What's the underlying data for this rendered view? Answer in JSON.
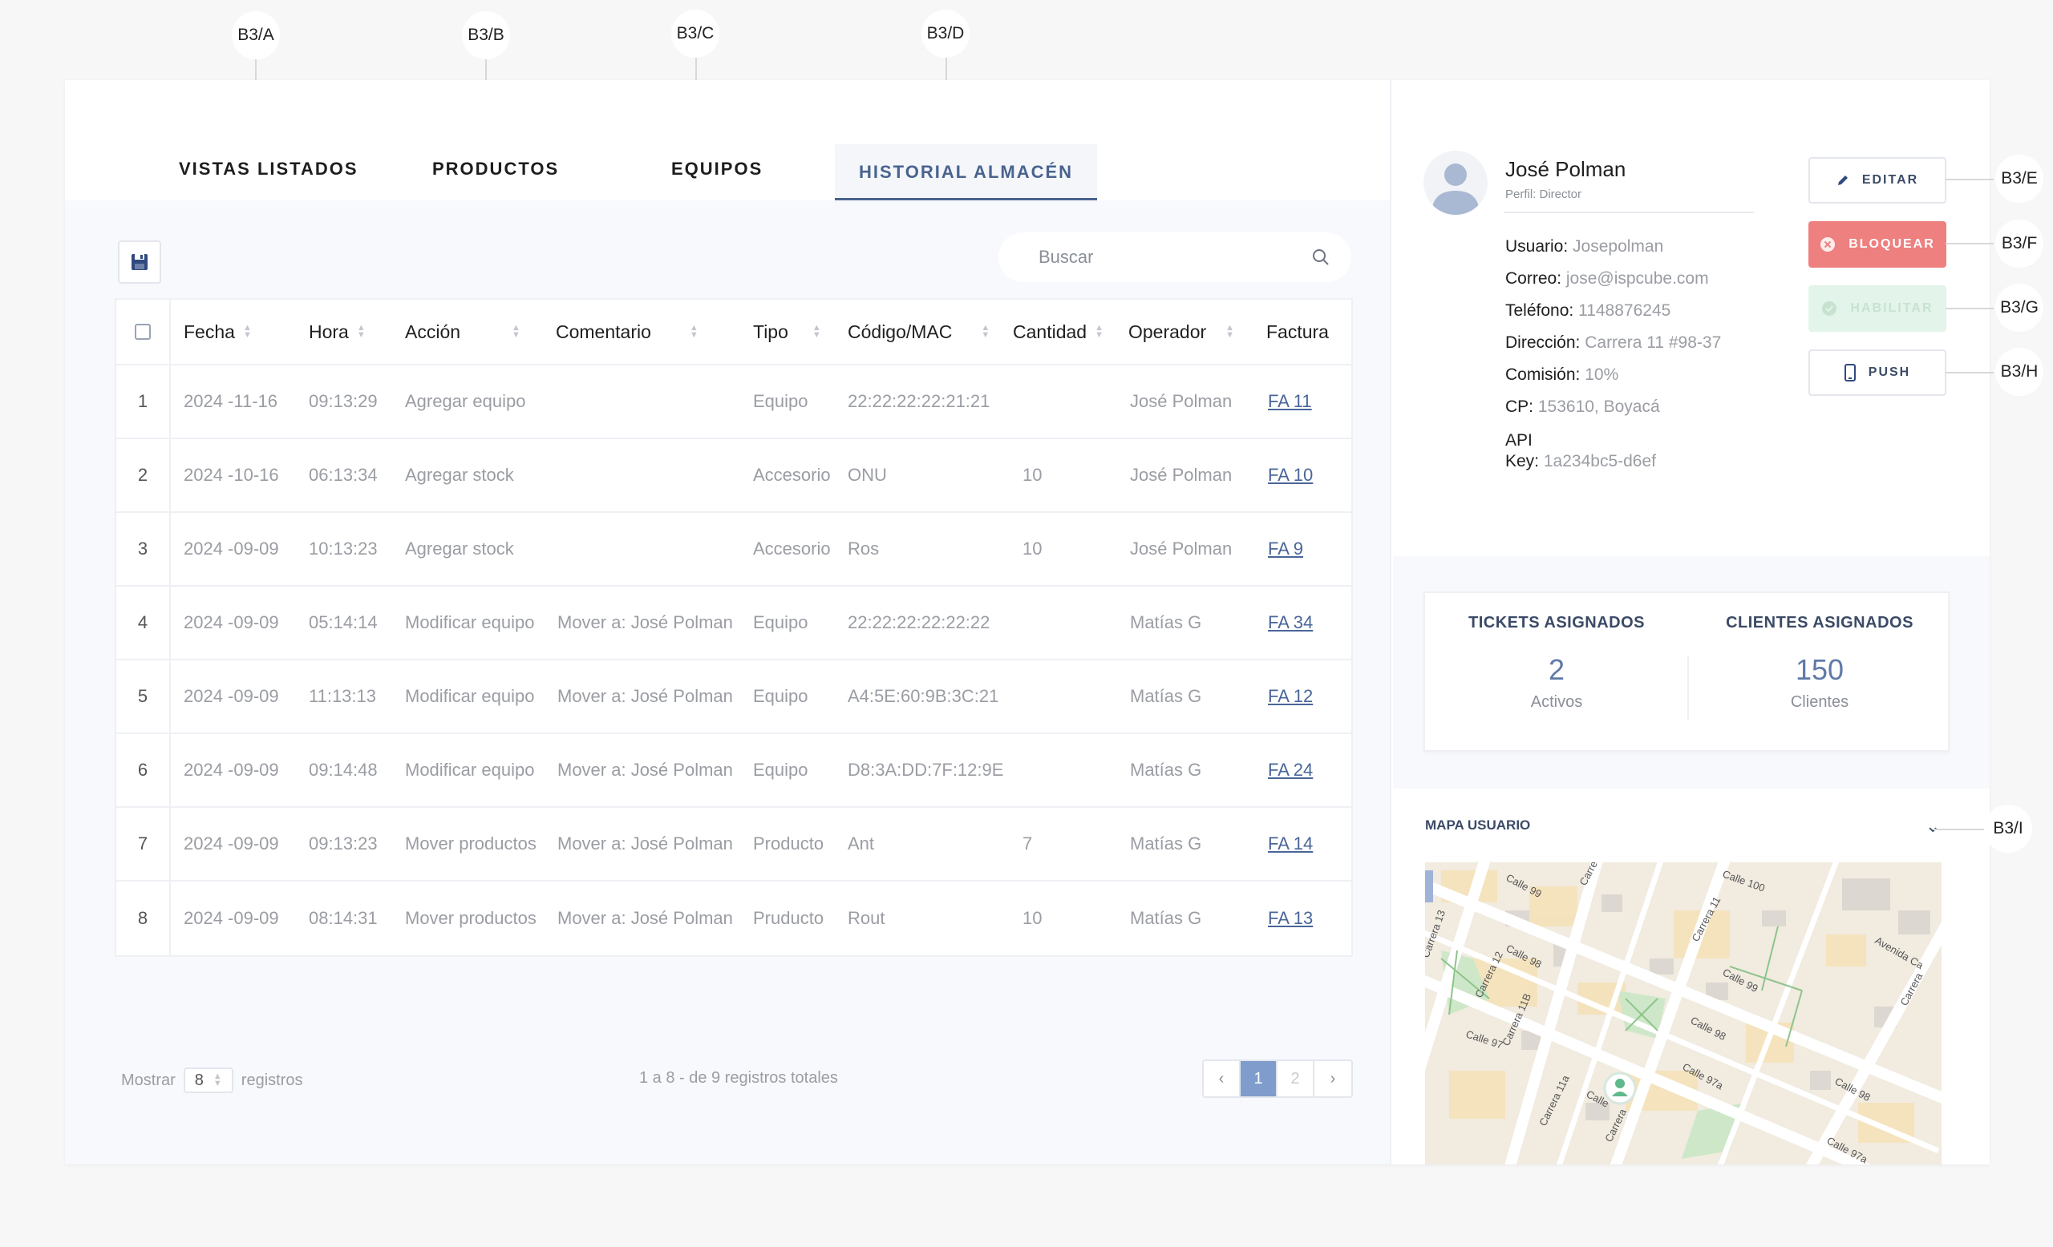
{
  "annotations": [
    "B3/A",
    "B3/B",
    "B3/C",
    "B3/D",
    "B3/E",
    "B3/F",
    "B3/G",
    "B3/H",
    "B3/I"
  ],
  "tabs": [
    {
      "label": "VISTAS LISTADOS"
    },
    {
      "label": "PRODUCTOS"
    },
    {
      "label": "EQUIPOS"
    },
    {
      "label": "HISTORIAL ALMACÉN"
    }
  ],
  "search": {
    "placeholder": "Buscar"
  },
  "table": {
    "headers": [
      "Fecha",
      "Hora",
      "Acción",
      "Comentario",
      "Tipo",
      "Código/MAC",
      "Cantidad",
      "Operador",
      "Factura"
    ],
    "rows": [
      {
        "n": "1",
        "fecha": "2024 -11-16",
        "hora": "09:13:29",
        "accion": "Agregar equipo",
        "comentario": "",
        "tipo": "Equipo",
        "codigo": "22:22:22:22:21:21",
        "cantidad": "",
        "operador": "José Polman",
        "factura": "FA 11"
      },
      {
        "n": "2",
        "fecha": "2024 -10-16",
        "hora": "06:13:34",
        "accion": "Agregar stock",
        "comentario": "",
        "tipo": "Accesorio",
        "codigo": "ONU",
        "cantidad": "10",
        "operador": "José Polman",
        "factura": "FA 10"
      },
      {
        "n": "3",
        "fecha": "2024 -09-09",
        "hora": "10:13:23",
        "accion": "Agregar stock",
        "comentario": "",
        "tipo": "Accesorio",
        "codigo": "Ros",
        "cantidad": "10",
        "operador": "José Polman",
        "factura": "FA 9"
      },
      {
        "n": "4",
        "fecha": "2024 -09-09",
        "hora": "05:14:14",
        "accion": "Modificar equipo",
        "comentario": "Mover a: José Polman",
        "tipo": "Equipo",
        "codigo": "22:22:22:22:22:22",
        "cantidad": "",
        "operador": "Matías G",
        "factura": "FA 34"
      },
      {
        "n": "5",
        "fecha": "2024 -09-09",
        "hora": "11:13:13",
        "accion": "Modificar equipo",
        "comentario": "Mover a: José Polman",
        "tipo": "Equipo",
        "codigo": "A4:5E:60:9B:3C:21",
        "cantidad": "",
        "operador": "Matías G",
        "factura": "FA 12"
      },
      {
        "n": "6",
        "fecha": "2024 -09-09",
        "hora": "09:14:48",
        "accion": "Modificar equipo",
        "comentario": "Mover a: José Polman",
        "tipo": "Equipo",
        "codigo": "D8:3A:DD:7F:12:9E",
        "cantidad": "",
        "operador": "Matías G",
        "factura": "FA 24"
      },
      {
        "n": "7",
        "fecha": "2024 -09-09",
        "hora": "09:13:23",
        "accion": "Mover productos",
        "comentario": "Mover a: José Polman",
        "tipo": "Producto",
        "codigo": "Ant",
        "cantidad": "7",
        "operador": "Matías G",
        "factura": "FA 14"
      },
      {
        "n": "8",
        "fecha": "2024 -09-09",
        "hora": "08:14:31",
        "accion": "Mover productos",
        "comentario": "Mover a: José Polman",
        "tipo": "Pruducto",
        "codigo": "Rout",
        "cantidad": "10",
        "operador": "Matías G",
        "factura": "FA 13"
      }
    ]
  },
  "footer": {
    "show_label": "Mostrar",
    "per_page": "8",
    "records_label": "registros",
    "summary": "1 a 8  - de 9 registros totales",
    "pages": [
      "1",
      "2"
    ]
  },
  "profile": {
    "name": "José Polman",
    "role": "Perfil: Director",
    "fields": [
      {
        "label": "Usuario:",
        "value": "Josepolman"
      },
      {
        "label": "Correo:",
        "value": "jose@ispcube.com"
      },
      {
        "label": "Teléfono:",
        "value": "1148876245"
      },
      {
        "label": "Dirección:",
        "value": "Carrera 11 #98-37"
      },
      {
        "label": "Comisión:",
        "value": "10%"
      },
      {
        "label": "CP:",
        "value": "153610, Boyacá"
      }
    ],
    "api_label_1": "API",
    "api_label_2": "Key:",
    "api_value": "1a234bc5-d6ef"
  },
  "actions": {
    "edit": "EDITAR",
    "block": "BLOQUEAR",
    "enable": "HABILITAR",
    "push": "PUSH"
  },
  "stats": [
    {
      "title": "TICKETS ASIGNADOS",
      "value": "2",
      "sub": "Activos"
    },
    {
      "title": "CLIENTES ASIGNADOS",
      "value": "150",
      "sub": "Clientes"
    }
  ],
  "map": {
    "title": "MAPA USUARIO",
    "street_labels": [
      "Calle 99",
      "Carrera",
      "Calle 100",
      "Carrera 11",
      "Avenida Ca",
      "Carrera 13",
      "Calle 98",
      "Carrera 12",
      "Carrera 11B",
      "Calle 99",
      "Calle 98",
      "Calle 97",
      "Calle 97a",
      "Carrera 11a",
      "Calle",
      "Carrera",
      "Calle 98",
      "Calle 97a",
      "Carrera"
    ]
  },
  "colors": {
    "accent": "#49638f",
    "danger": "#ee8080",
    "success_muted": "#e3f4ea",
    "pager_active": "#7f9ccc"
  }
}
